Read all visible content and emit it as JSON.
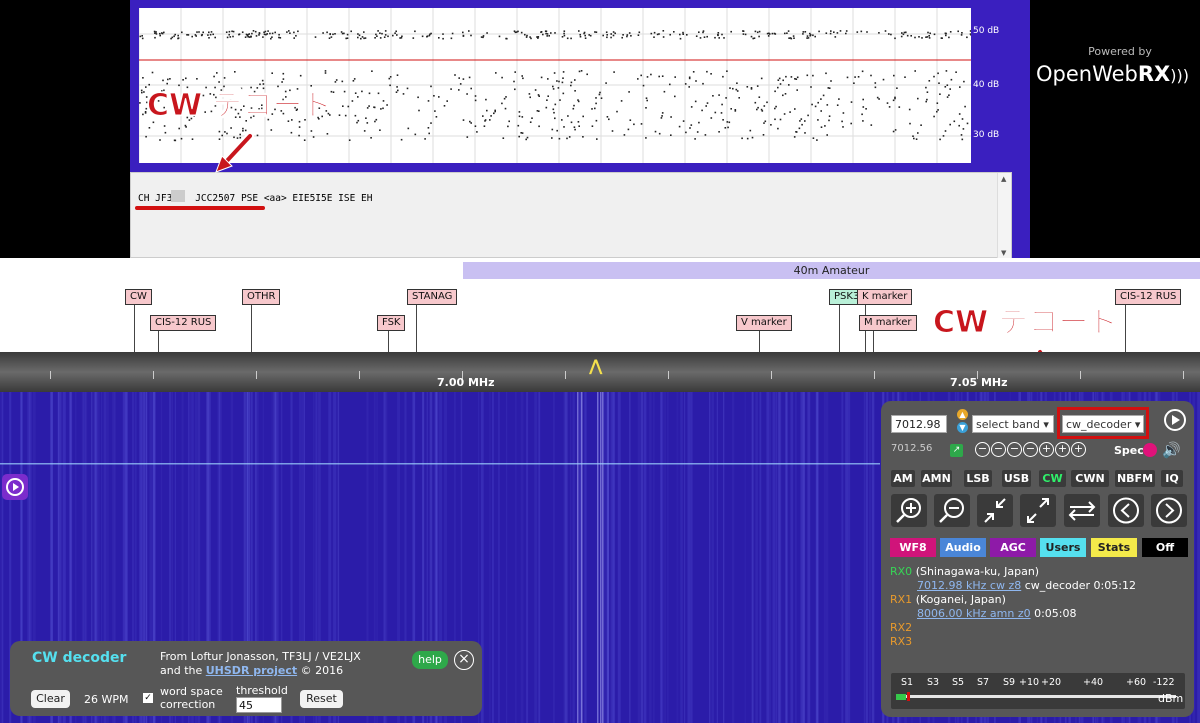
{
  "decoder_plot": {
    "db_labels": [
      "50 dB",
      "40 dB",
      "30 dB"
    ],
    "decoded_text": "CH JF3H   JCC2507 PSE <aa> EIE5I5E ISE EH"
  },
  "annotations": {
    "top": "CW デコード",
    "right": "CW デコード"
  },
  "branding": {
    "powered_by": "Powered by",
    "logo_main": "OpenWeb",
    "logo_bold": "RX"
  },
  "band": {
    "label": "40m Amateur"
  },
  "bookmarks": [
    {
      "label": "CW"
    },
    {
      "label": "CIS-12 RUS"
    },
    {
      "label": "OTHR"
    },
    {
      "label": "FSK"
    },
    {
      "label": "STANAG"
    },
    {
      "label": "V marker"
    },
    {
      "label": "PSK3",
      "color": "#b9f0d8"
    },
    {
      "label": "K marker"
    },
    {
      "label": "M marker"
    },
    {
      "label": "CIS-12 RUS"
    }
  ],
  "scale": {
    "labels": [
      "7.00 MHz",
      "7.05 MHz"
    ]
  },
  "receiver": {
    "frequency": "7012.98",
    "band_select": "select band",
    "mode_select": "cw_decoder",
    "offset_frequency": "7012.56",
    "spec_label": "Spec",
    "modes": [
      "AM",
      "AMN",
      "LSB",
      "USB",
      "CW",
      "CWN",
      "NBFM",
      "IQ"
    ],
    "active_mode": "CW",
    "tabs": [
      {
        "label": "WF8",
        "bg": "#d0147a",
        "fg": "#ffffff"
      },
      {
        "label": "Audio",
        "bg": "#4a86d8",
        "fg": "#ffffff"
      },
      {
        "label": "AGC",
        "bg": "#8e1aa8",
        "fg": "#ffffff"
      },
      {
        "label": "Users",
        "bg": "#55e0ef",
        "fg": "#222222"
      },
      {
        "label": "Stats",
        "bg": "#f4ea4a",
        "fg": "#222222"
      },
      {
        "label": "Off",
        "bg": "#000000",
        "fg": "#ffffff"
      }
    ],
    "users": {
      "rx0_label": "RX0",
      "rx0_location": "(Shinagawa-ku, Japan)",
      "rx0_link": "7012.98 kHz cw z8",
      "rx0_detail": "cw_decoder 0:05:12",
      "rx1_label": "RX1",
      "rx1_location": "(Koganei, Japan)",
      "rx1_link": "8006.00 kHz amn z0",
      "rx1_detail": "0:05:08",
      "rx2_label": "RX2",
      "rx3_label": "RX3"
    },
    "colors": {
      "rx0": "#36d656",
      "rx_other": "#e89a2c"
    },
    "smeter": {
      "labels": [
        "S1",
        "S3",
        "S5",
        "S7",
        "S9",
        "+10",
        "+20",
        "+40",
        "+60",
        "-122"
      ],
      "unit": "dBm"
    }
  },
  "cw_decoder": {
    "title": "CW decoder",
    "credit_line1": "From Loftur Jonasson, TF3LJ / VE2LJX",
    "credit_prefix": "and the",
    "credit_link": "UHSDR project",
    "credit_suffix": "© 2016",
    "help": "help",
    "clear": "Clear",
    "wpm": "26 WPM",
    "word_space_line1": "word space",
    "word_space_line2": "correction",
    "threshold_label": "threshold",
    "threshold_value": "45",
    "reset": "Reset"
  }
}
